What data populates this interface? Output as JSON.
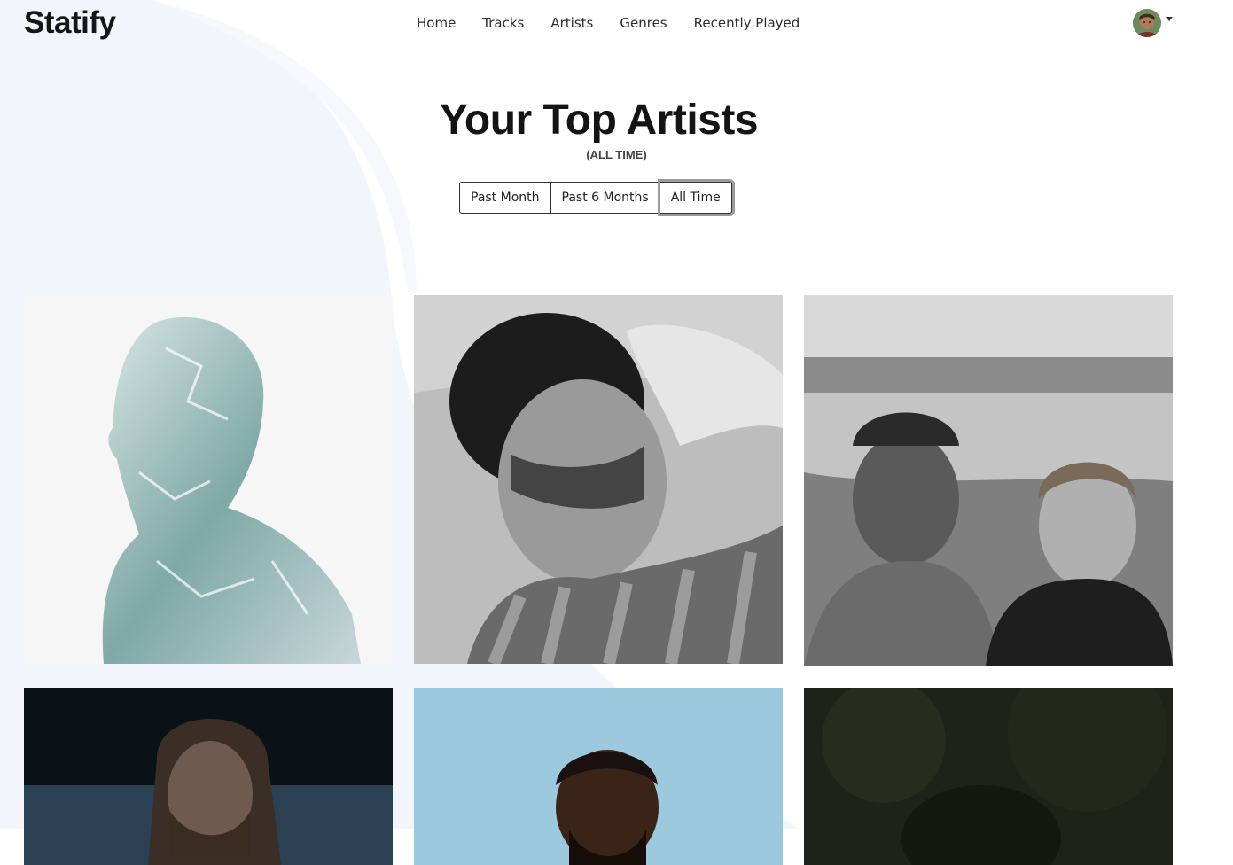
{
  "app": {
    "brand": "Statify"
  },
  "nav": {
    "items": [
      "Home",
      "Tracks",
      "Artists",
      "Genres",
      "Recently Played"
    ]
  },
  "header": {
    "title": "Your Top Artists",
    "period_label": "(ALL TIME)"
  },
  "time_range": {
    "options": [
      "Past Month",
      "Past 6 Months",
      "All Time"
    ],
    "selected": "All Time"
  },
  "icons": {
    "user_menu": "avatar-icon",
    "dropdown": "chevron-down-icon"
  },
  "colors": {
    "background": "#ffffff",
    "accent_shape": "#f3f5fc",
    "text": "#111111"
  }
}
